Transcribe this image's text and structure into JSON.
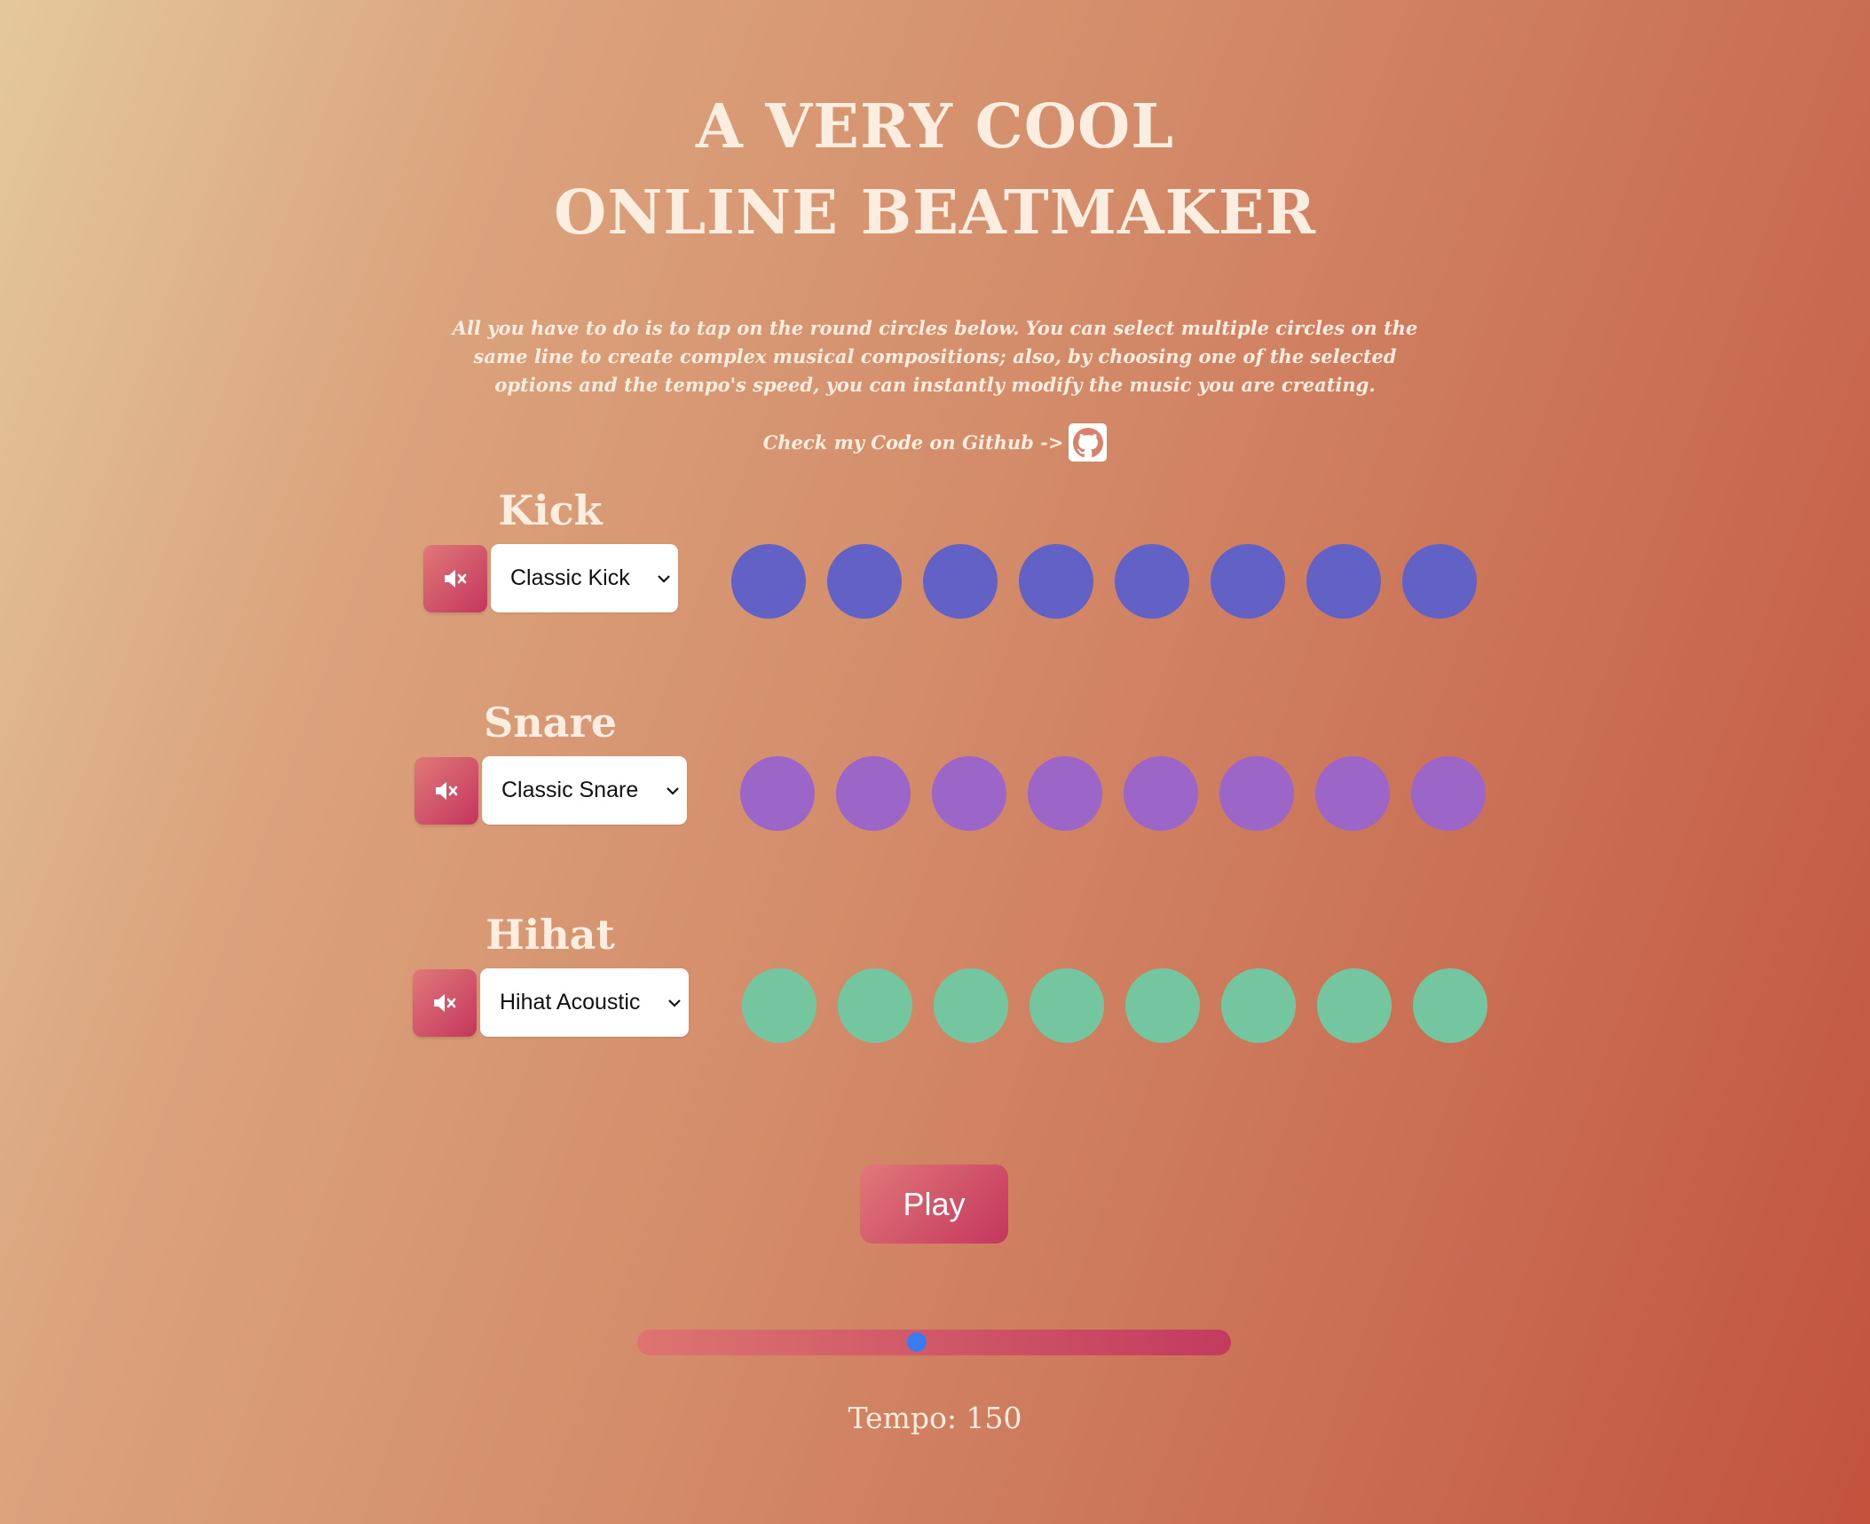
{
  "header": {
    "title_line1": "A VERY COOL",
    "title_line2": "ONLINE BEATMAKER",
    "description": "All you have to do is to tap on the round circles below. You can select multiple circles on the same line to create complex musical compositions; also, by choosing one of the selected options and the tempo's speed, you can instantly modify the music you are creating.",
    "github_text": "Check my Code on Github ->",
    "github_icon": "github-icon"
  },
  "colors": {
    "kick_pad": "#6261c6",
    "snare_pad": "#9c66c8",
    "hihat_pad": "#74c6a0",
    "button_gradient_start": "#e07878",
    "button_gradient_end": "#c4365e",
    "slider_thumb": "#3a7bf0"
  },
  "tracks": [
    {
      "label": "Kick",
      "sound": "Classic Kick",
      "mute_icon": "mute-icon",
      "pad_count": 8
    },
    {
      "label": "Snare",
      "sound": "Classic Snare",
      "mute_icon": "mute-icon",
      "pad_count": 8
    },
    {
      "label": "Hihat",
      "sound": "Hihat Acoustic",
      "mute_icon": "mute-icon",
      "pad_count": 8
    }
  ],
  "controls": {
    "play_label": "Play",
    "tempo_text": "Tempo: 150",
    "tempo_fraction": 0.47
  }
}
